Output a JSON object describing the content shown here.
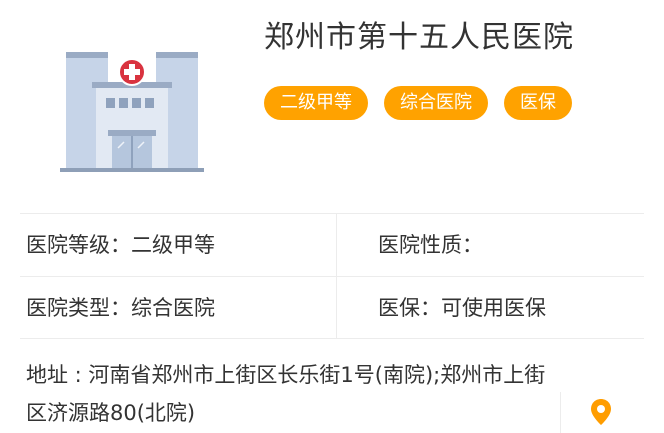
{
  "hospital": {
    "name": "郑州市第十五人民医院",
    "tags": [
      {
        "label": "二级甲等"
      },
      {
        "label": "综合医院"
      },
      {
        "label": "医保"
      }
    ]
  },
  "info": {
    "level": "医院等级：二级甲等",
    "nature": "医院性质：",
    "type": "医院类型：综合医院",
    "insurance": "医保：可使用医保"
  },
  "address": {
    "text": "地址 : 河南省郑州市上街区长乐街1号(南院);郑州市上街区济源路80(北院)"
  },
  "icons": {
    "hospital": "hospital-building-icon",
    "location": "map-pin-icon"
  },
  "colors": {
    "tag": "#ffa200",
    "pin": "#ff9d00",
    "cross": "#d9333f"
  }
}
